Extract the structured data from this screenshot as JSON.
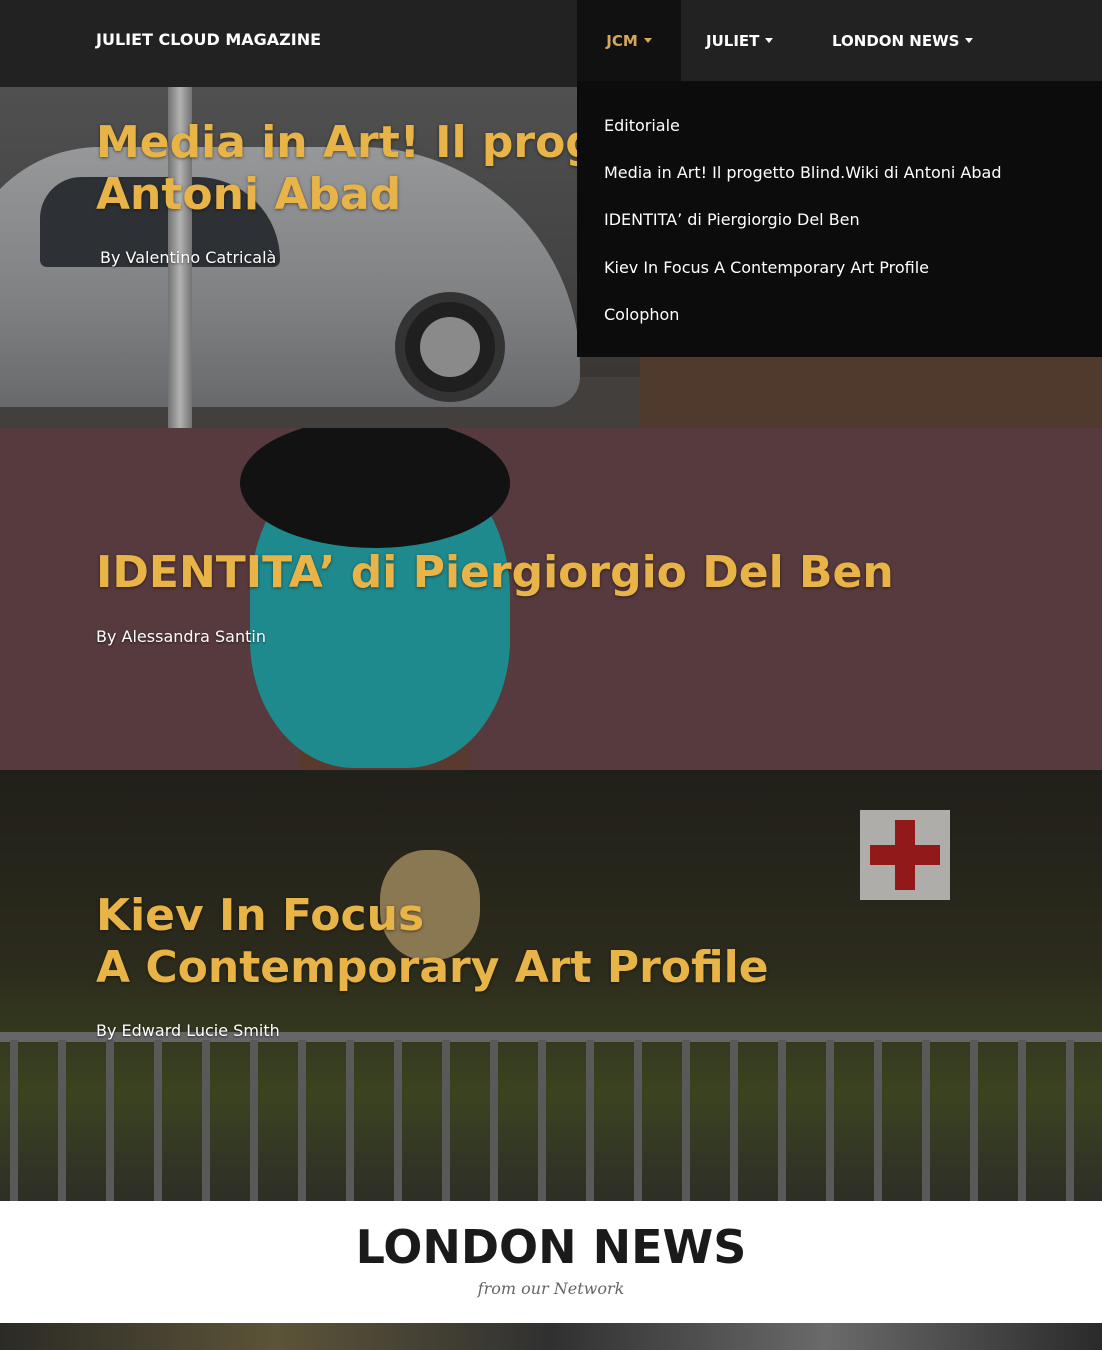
{
  "navbar": {
    "brand": "JULIET CLOUD MAGAZINE",
    "items": [
      {
        "label": "JCM",
        "active": true
      },
      {
        "label": "JULIET",
        "active": false
      },
      {
        "label": "LONDON NEWS",
        "active": false
      }
    ]
  },
  "dropdown": {
    "items": [
      "Editoriale",
      "Media in Art! Il progetto Blind.Wiki di Antoni Abad",
      "IDENTITA’ di Piergiorgio Del Ben",
      "Kiev In Focus A Contemporary Art Profile",
      "Colophon"
    ]
  },
  "articles": [
    {
      "title_line1": "Media in Art! Il progetto Blind.Wiki di",
      "title_line2": "Antoni Abad",
      "byline": "By Valentino Catricalà"
    },
    {
      "title_line1": "IDENTITA’ di Piergiorgio Del Ben",
      "byline": "By Alessandra Santin"
    },
    {
      "title_line1": "Kiev In Focus",
      "title_line2": "A Contemporary Art Profile",
      "byline": "By Edward Lucie Smith"
    }
  ],
  "news_section": {
    "title": "LONDON NEWS",
    "subtitle": "from our Network"
  },
  "colors": {
    "accent": "#e8b447",
    "nav_active": "#d8a65a",
    "navbar_bg": "#222222",
    "dropdown_bg": "#0c0c0c",
    "section2_bg": "#573a3e"
  }
}
